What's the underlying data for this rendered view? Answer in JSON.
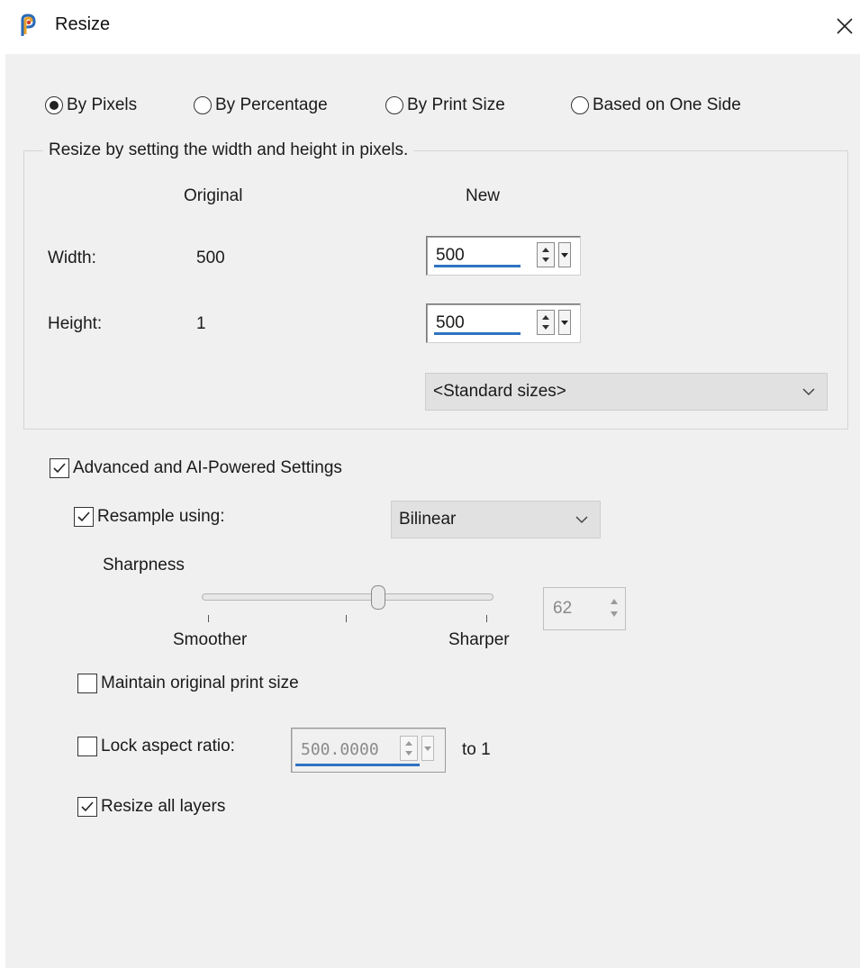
{
  "window": {
    "title": "Resize",
    "close_glyph": "✕"
  },
  "mode_options": [
    {
      "label": "By Pixels",
      "selected": true
    },
    {
      "label": "By Percentage",
      "selected": false
    },
    {
      "label": "By Print Size",
      "selected": false
    },
    {
      "label": "Based on One Side",
      "selected": false
    }
  ],
  "pixel_group": {
    "legend": "Resize by setting the width and height in pixels.",
    "col_original": "Original",
    "col_new": "New",
    "width_label": "Width:",
    "width_original": "500",
    "width_new": "500",
    "height_label": "Height:",
    "height_original": "1",
    "height_new": "500",
    "standard_sizes": "<Standard sizes>"
  },
  "advanced": {
    "label": "Advanced and AI-Powered Settings",
    "checked": true,
    "resample_label": "Resample using:",
    "resample_checked": true,
    "resample_method": "Bilinear",
    "sharpness_label": "Sharpness",
    "sharpness_value": "62",
    "smoother_label": "Smoother",
    "sharper_label": "Sharper",
    "maintain_print_label": "Maintain original print size",
    "maintain_print_checked": false,
    "lock_aspect_label": "Lock aspect ratio:",
    "lock_aspect_checked": false,
    "aspect_value": "500.0000",
    "aspect_suffix": "to 1",
    "resize_layers_label": "Resize all layers",
    "resize_layers_checked": true
  },
  "icons": {
    "app": "paintshop-app-icon",
    "close": "close-icon",
    "dropdown": "chevron-down-icon",
    "check": "checkmark-icon"
  },
  "colors": {
    "panel_bg": "#f0f0f0",
    "accent_underline": "#2f73c1",
    "dropdown_bg": "#e1e1e1"
  }
}
